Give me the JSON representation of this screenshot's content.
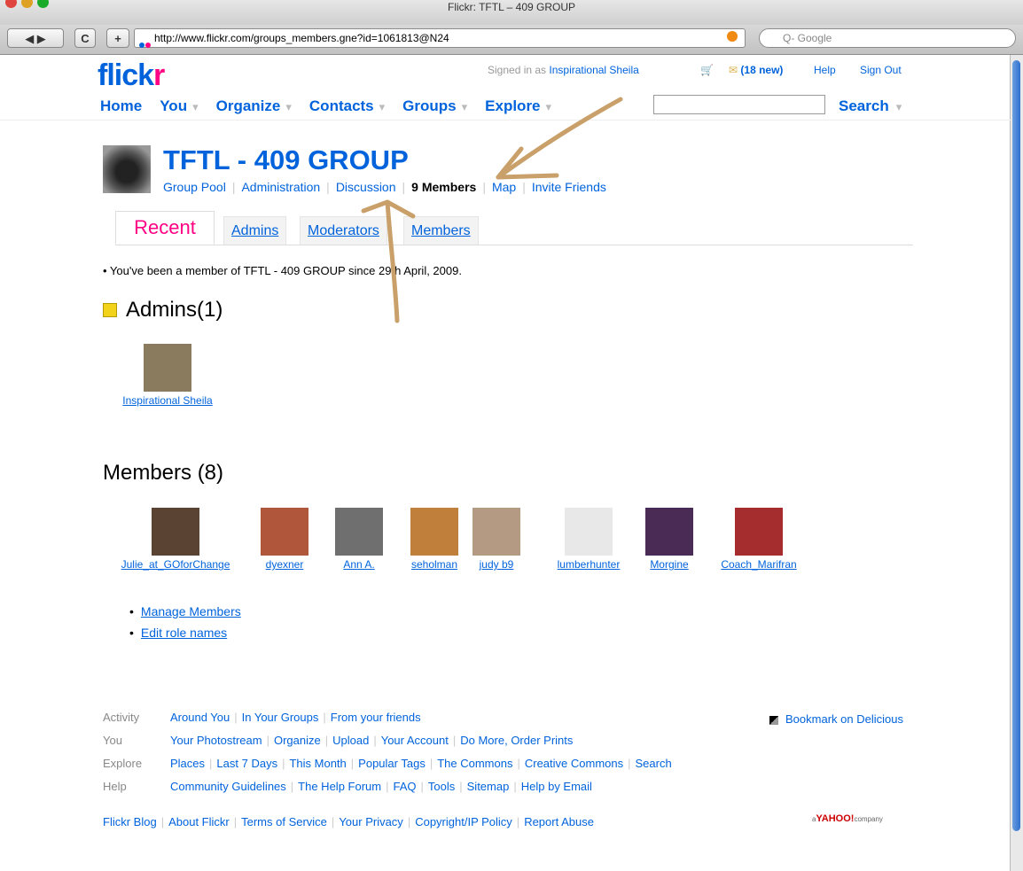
{
  "browser": {
    "window_title": "Flickr: TFTL – 409 GROUP",
    "back_fwd": "◀ ▶",
    "reload": "C",
    "newtab": "+",
    "url": "http://www.flickr.com/groups_members.gne?id=1061813@N24",
    "search_placeholder": "Q- Google"
  },
  "header": {
    "logo_f": "flick",
    "logo_r": "r",
    "signed_in_prefix": "Signed in as",
    "user_name": "Inspirational Sheila",
    "mail_count": "(18 new)",
    "help": "Help",
    "sign_out": "Sign Out",
    "nav": [
      "Home",
      "You",
      "Organize",
      "Contacts",
      "Groups",
      "Explore"
    ],
    "search_button": "Search"
  },
  "group": {
    "title": "TFTL - 409 GROUP",
    "nav": [
      "Group Pool",
      "Administration",
      "Discussion"
    ],
    "members_link": "9 Members",
    "nav_after": [
      "Map",
      "Invite Friends"
    ]
  },
  "tabs": {
    "active": "Recent",
    "others": [
      "Admins",
      "Moderators",
      "Members"
    ]
  },
  "membership_note": "• You've been a member of TFTL - 409 GROUP since 29th April, 2009.",
  "admins": {
    "heading": "Admins(1)",
    "list": [
      {
        "name": "Inspirational Sheila",
        "color": "#8a7a5e"
      }
    ]
  },
  "members": {
    "heading": "Members (8)",
    "list": [
      {
        "name": "Julie_at_GOforChange",
        "color": "#5b4334"
      },
      {
        "name": "dyexner",
        "color": "#b0563a"
      },
      {
        "name": "Ann A.",
        "color": "#6f6f6f"
      },
      {
        "name": "seholman",
        "color": "#c0803b"
      },
      {
        "name": "judy b9",
        "color": "#b49a82"
      },
      {
        "name": "lumberhunter",
        "color": "#e8e8e8"
      },
      {
        "name": "Morgine",
        "color": "#4a2b55"
      },
      {
        "name": "Coach_Marifran",
        "color": "#a52d2d"
      }
    ]
  },
  "manage_links": [
    "Manage Members",
    "Edit role names"
  ],
  "footer": {
    "rows": [
      {
        "label": "Activity",
        "links": [
          "Around You",
          "In Your Groups",
          "From your friends"
        ]
      },
      {
        "label": "You",
        "links": [
          "Your Photostream",
          "Organize",
          "Upload",
          "Your Account",
          "Do More, Order Prints"
        ]
      },
      {
        "label": "Explore",
        "links": [
          "Places",
          "Last 7 Days",
          "This Month",
          "Popular Tags",
          "The Commons",
          "Creative Commons",
          "Search"
        ]
      },
      {
        "label": "Help",
        "links": [
          "Community Guidelines",
          "The Help Forum",
          "FAQ",
          "Tools",
          "Sitemap",
          "Help by Email"
        ]
      }
    ],
    "bottom_links": [
      "Flickr Blog",
      "About Flickr",
      "Terms of Service",
      "Your Privacy",
      "Copyright/IP Policy",
      "Report Abuse"
    ],
    "bookmark": "Bookmark on Delicious",
    "yahoo_prefix": "a",
    "yahoo": "YAHOO!",
    "yahoo_suffix": "company"
  },
  "colors": {
    "link_blue": "#0063DC",
    "flickr_pink": "#FF0084",
    "annotation": "#c9a06a"
  }
}
